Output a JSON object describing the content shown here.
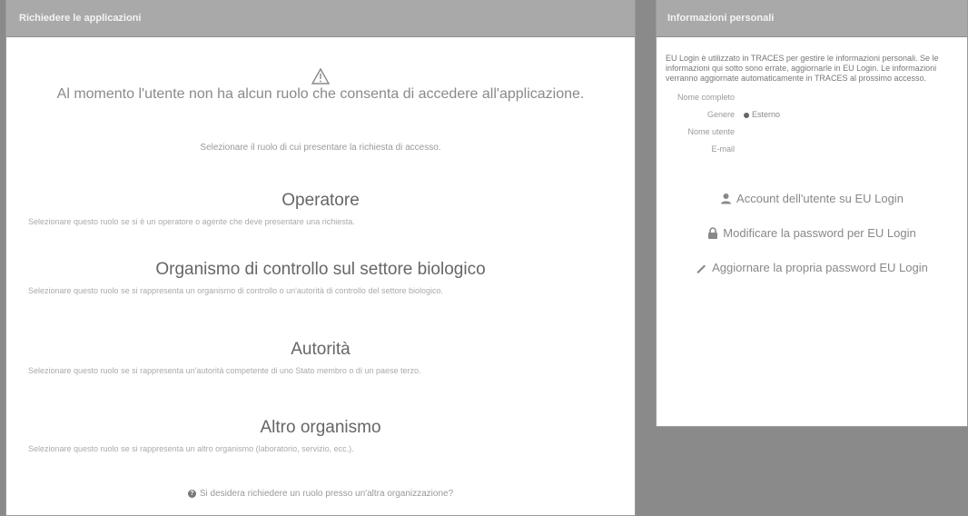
{
  "left_panel": {
    "header": "Richiedere le applicazioni",
    "no_role_message": "Al momento l'utente non ha alcun ruolo che consenta di accedere all'applicazione.",
    "select_hint": "Selezionare il ruolo di cui presentare la richiesta di accesso.",
    "roles": [
      {
        "title": "Operatore",
        "description": "Selezionare questo ruolo se si è un operatore o agente che deve presentare una richiesta."
      },
      {
        "title": "Organismo di controllo sul settore biologico",
        "description": "Selezionare questo ruolo se si rappresenta un organismo di controllo o un'autorità di controllo del settore biologico."
      },
      {
        "title": "Autorità",
        "description": "Selezionare questo ruolo se si rappresenta un'autorità competente di uno Stato membro o di un paese terzo."
      },
      {
        "title": "Altro organismo",
        "description": "Selezionare questo ruolo se si rappresenta un altro organismo (laboratorio, servizio, ecc.)."
      }
    ],
    "footer_question": "Si desidera richiedere un ruolo presso un'altra organizzazione?"
  },
  "right_panel": {
    "header": "Informazioni personali",
    "intro": "EU Login è utilizzato in TRACES per gestire le informazioni personali. Se le informazioni qui sotto sono errate, aggiornarle in EU Login. Le informazioni verranno aggiornate automaticamente in TRACES al prossimo accesso.",
    "fields": [
      {
        "label": "Nome completo",
        "value": ""
      },
      {
        "label": "Genere",
        "value": "Esterno"
      },
      {
        "label": "Nome utente",
        "value": ""
      },
      {
        "label": "E-mail",
        "value": ""
      }
    ],
    "links": {
      "account": "Account dell'utente su EU Login",
      "password": "Modificare la password per EU Login",
      "mobile_password": "Aggiornare la propria password EU Login"
    }
  }
}
